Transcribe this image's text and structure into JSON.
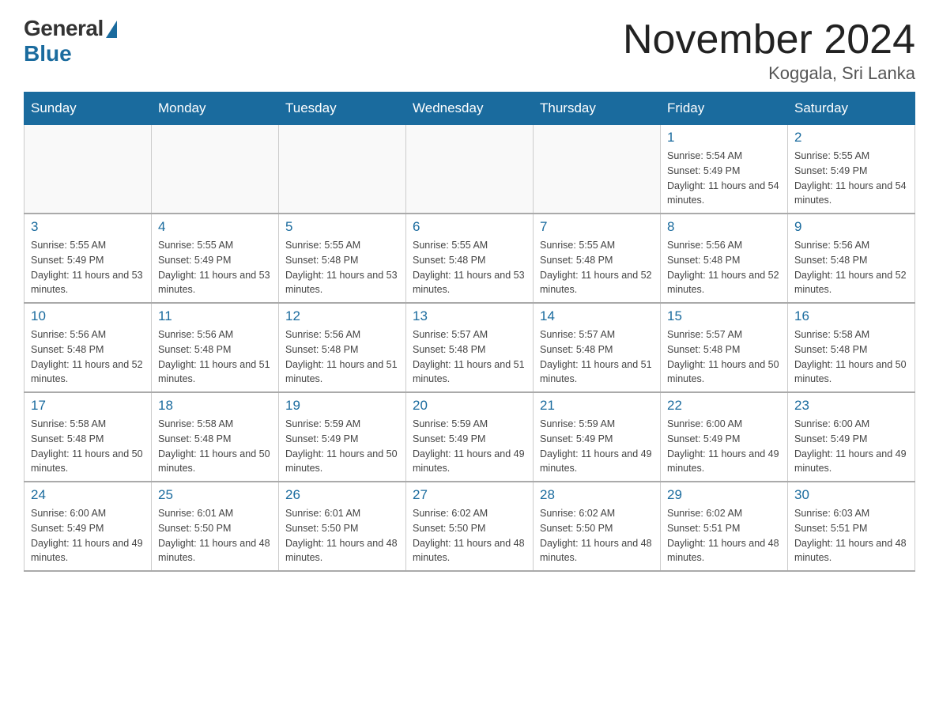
{
  "header": {
    "logo": {
      "general": "General",
      "blue": "Blue"
    },
    "title": "November 2024",
    "location": "Koggala, Sri Lanka"
  },
  "weekdays": [
    "Sunday",
    "Monday",
    "Tuesday",
    "Wednesday",
    "Thursday",
    "Friday",
    "Saturday"
  ],
  "weeks": [
    {
      "days": [
        {
          "num": "",
          "info": ""
        },
        {
          "num": "",
          "info": ""
        },
        {
          "num": "",
          "info": ""
        },
        {
          "num": "",
          "info": ""
        },
        {
          "num": "",
          "info": ""
        },
        {
          "num": "1",
          "info": "Sunrise: 5:54 AM\nSunset: 5:49 PM\nDaylight: 11 hours and 54 minutes."
        },
        {
          "num": "2",
          "info": "Sunrise: 5:55 AM\nSunset: 5:49 PM\nDaylight: 11 hours and 54 minutes."
        }
      ]
    },
    {
      "days": [
        {
          "num": "3",
          "info": "Sunrise: 5:55 AM\nSunset: 5:49 PM\nDaylight: 11 hours and 53 minutes."
        },
        {
          "num": "4",
          "info": "Sunrise: 5:55 AM\nSunset: 5:49 PM\nDaylight: 11 hours and 53 minutes."
        },
        {
          "num": "5",
          "info": "Sunrise: 5:55 AM\nSunset: 5:48 PM\nDaylight: 11 hours and 53 minutes."
        },
        {
          "num": "6",
          "info": "Sunrise: 5:55 AM\nSunset: 5:48 PM\nDaylight: 11 hours and 53 minutes."
        },
        {
          "num": "7",
          "info": "Sunrise: 5:55 AM\nSunset: 5:48 PM\nDaylight: 11 hours and 52 minutes."
        },
        {
          "num": "8",
          "info": "Sunrise: 5:56 AM\nSunset: 5:48 PM\nDaylight: 11 hours and 52 minutes."
        },
        {
          "num": "9",
          "info": "Sunrise: 5:56 AM\nSunset: 5:48 PM\nDaylight: 11 hours and 52 minutes."
        }
      ]
    },
    {
      "days": [
        {
          "num": "10",
          "info": "Sunrise: 5:56 AM\nSunset: 5:48 PM\nDaylight: 11 hours and 52 minutes."
        },
        {
          "num": "11",
          "info": "Sunrise: 5:56 AM\nSunset: 5:48 PM\nDaylight: 11 hours and 51 minutes."
        },
        {
          "num": "12",
          "info": "Sunrise: 5:56 AM\nSunset: 5:48 PM\nDaylight: 11 hours and 51 minutes."
        },
        {
          "num": "13",
          "info": "Sunrise: 5:57 AM\nSunset: 5:48 PM\nDaylight: 11 hours and 51 minutes."
        },
        {
          "num": "14",
          "info": "Sunrise: 5:57 AM\nSunset: 5:48 PM\nDaylight: 11 hours and 51 minutes."
        },
        {
          "num": "15",
          "info": "Sunrise: 5:57 AM\nSunset: 5:48 PM\nDaylight: 11 hours and 50 minutes."
        },
        {
          "num": "16",
          "info": "Sunrise: 5:58 AM\nSunset: 5:48 PM\nDaylight: 11 hours and 50 minutes."
        }
      ]
    },
    {
      "days": [
        {
          "num": "17",
          "info": "Sunrise: 5:58 AM\nSunset: 5:48 PM\nDaylight: 11 hours and 50 minutes."
        },
        {
          "num": "18",
          "info": "Sunrise: 5:58 AM\nSunset: 5:48 PM\nDaylight: 11 hours and 50 minutes."
        },
        {
          "num": "19",
          "info": "Sunrise: 5:59 AM\nSunset: 5:49 PM\nDaylight: 11 hours and 50 minutes."
        },
        {
          "num": "20",
          "info": "Sunrise: 5:59 AM\nSunset: 5:49 PM\nDaylight: 11 hours and 49 minutes."
        },
        {
          "num": "21",
          "info": "Sunrise: 5:59 AM\nSunset: 5:49 PM\nDaylight: 11 hours and 49 minutes."
        },
        {
          "num": "22",
          "info": "Sunrise: 6:00 AM\nSunset: 5:49 PM\nDaylight: 11 hours and 49 minutes."
        },
        {
          "num": "23",
          "info": "Sunrise: 6:00 AM\nSunset: 5:49 PM\nDaylight: 11 hours and 49 minutes."
        }
      ]
    },
    {
      "days": [
        {
          "num": "24",
          "info": "Sunrise: 6:00 AM\nSunset: 5:49 PM\nDaylight: 11 hours and 49 minutes."
        },
        {
          "num": "25",
          "info": "Sunrise: 6:01 AM\nSunset: 5:50 PM\nDaylight: 11 hours and 48 minutes."
        },
        {
          "num": "26",
          "info": "Sunrise: 6:01 AM\nSunset: 5:50 PM\nDaylight: 11 hours and 48 minutes."
        },
        {
          "num": "27",
          "info": "Sunrise: 6:02 AM\nSunset: 5:50 PM\nDaylight: 11 hours and 48 minutes."
        },
        {
          "num": "28",
          "info": "Sunrise: 6:02 AM\nSunset: 5:50 PM\nDaylight: 11 hours and 48 minutes."
        },
        {
          "num": "29",
          "info": "Sunrise: 6:02 AM\nSunset: 5:51 PM\nDaylight: 11 hours and 48 minutes."
        },
        {
          "num": "30",
          "info": "Sunrise: 6:03 AM\nSunset: 5:51 PM\nDaylight: 11 hours and 48 minutes."
        }
      ]
    }
  ]
}
